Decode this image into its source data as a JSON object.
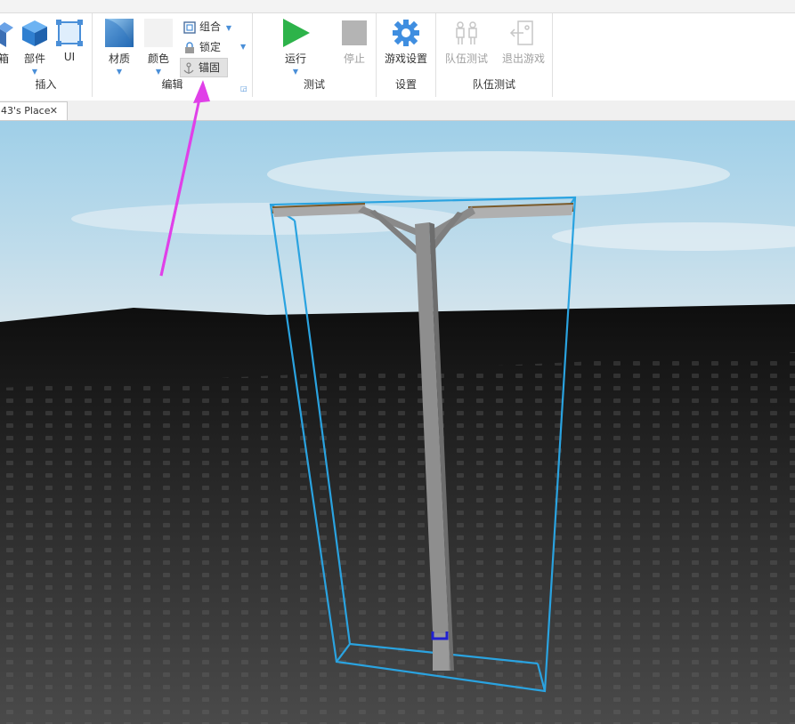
{
  "ribbon": {
    "insert_group": {
      "label": "插入",
      "toolbox_label_fragment": "箱",
      "part_label": "部件",
      "ui_label": "UI"
    },
    "edit_group": {
      "label": "编辑",
      "material_label": "材质",
      "color_label": "颜色",
      "group_label": "组合",
      "lock_label": "锁定",
      "anchor_label": "锚固"
    },
    "test_group": {
      "label": "测试",
      "run_label": "运行",
      "stop_label": "停止"
    },
    "settings_group": {
      "label": "设置",
      "game_settings_label": "游戏设置"
    },
    "team_test_group": {
      "label": "队伍测试",
      "team_test_label": "队伍测试",
      "exit_game_label": "退出游戏"
    }
  },
  "tabs": [
    {
      "label": "43's Place",
      "close": "✕"
    }
  ],
  "colors": {
    "accent_blue": "#4a8fd8",
    "selection_box": "#2aa3e0",
    "annotation_arrow": "#e040e8",
    "run_green": "#2db34a"
  }
}
